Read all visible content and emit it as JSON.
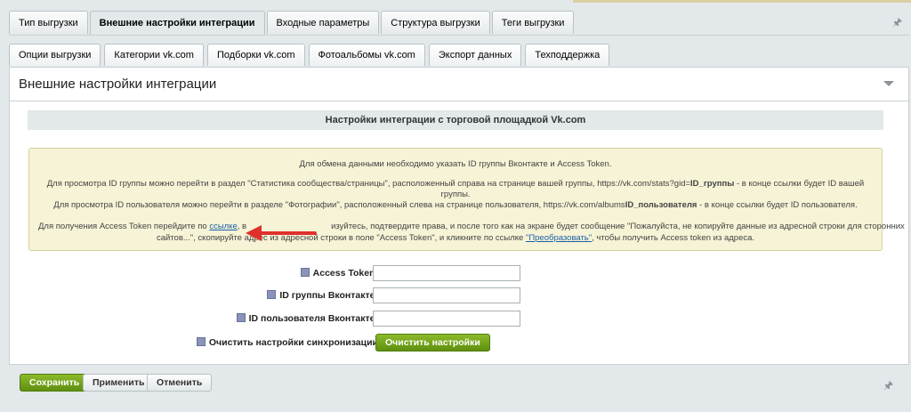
{
  "tabs_top": [
    {
      "label": "Тип выгрузки",
      "active": false
    },
    {
      "label": "Внешние настройки интеграции",
      "active": true
    },
    {
      "label": "Входные параметры",
      "active": false
    },
    {
      "label": "Структура выгрузки",
      "active": false
    },
    {
      "label": "Теги выгрузки",
      "active": false
    }
  ],
  "tabs_sub": [
    {
      "label": "Опции выгрузки",
      "active": false
    },
    {
      "label": "Категории vk.com",
      "active": false
    },
    {
      "label": "Подборки vk.com",
      "active": false
    },
    {
      "label": "Фотоальбомы vk.com",
      "active": false
    },
    {
      "label": "Экспорт данных",
      "active": false
    },
    {
      "label": "Техподдержка",
      "active": false
    }
  ],
  "panel": {
    "title": "Внешние настройки интеграции",
    "section_title": "Настройки интеграции с торговой площадкой Vk.com"
  },
  "note": {
    "line1": "Для обмена данными необходимо указать ID группы Вконтакте и Access Token.",
    "line2_a": "Для просмотра ID группы можно перейти в раздел \"Статистика сообщества/страницы\", расположенный справа на странице вашей группы, https://vk.com/stats?gid=",
    "line2_b": "ID_группы",
    "line2_c": " - в конце ссылки будет ID вашей группы.",
    "line3_a": "Для просмотра ID пользователя можно перейти в разделе \"Фотографии\", расположенный слева на странице пользователя, https://vk.com/albums",
    "line3_b": "ID_пользователя",
    "line3_c": " - в конце ссылки будет ID пользователя.",
    "line4_a": "Для получения Access Token перейдите по ",
    "line4_link": "ссылке",
    "line4_b": ", в                                    изуйтесь, подтвердите права, и после того как на экране будет сообщение \"Пожалуйста, не копируйте данные из адресной строки для сторонних",
    "line5_a": "сайтов...\", скопируйте адрес из адресной строки в поле \"Access Token\", и кликните по ссылке ",
    "line5_link": "\"Преобразовать\"",
    "line5_b": ", чтобы получить Access token из адреса."
  },
  "form": {
    "access_token_label": "Access Token:",
    "access_token_value": "",
    "group_id_label": "ID группы Вконтакте:",
    "group_id_value": "",
    "user_id_label": "ID пользователя Вконтакте:",
    "user_id_value": "",
    "clear_label": "Очистить настройки синхронизации",
    "clear_button": "Очистить настройки"
  },
  "buttons": {
    "save": "Сохранить",
    "apply": "Применить",
    "cancel": "Отменить"
  },
  "colors": {
    "arrow": "#e0302c",
    "accent_green": "#6fa01a"
  },
  "icons": {
    "pin": "pin-icon",
    "collapse": "chevron-down-icon",
    "hint": "hint-icon",
    "arrow": "arrow-icon"
  }
}
